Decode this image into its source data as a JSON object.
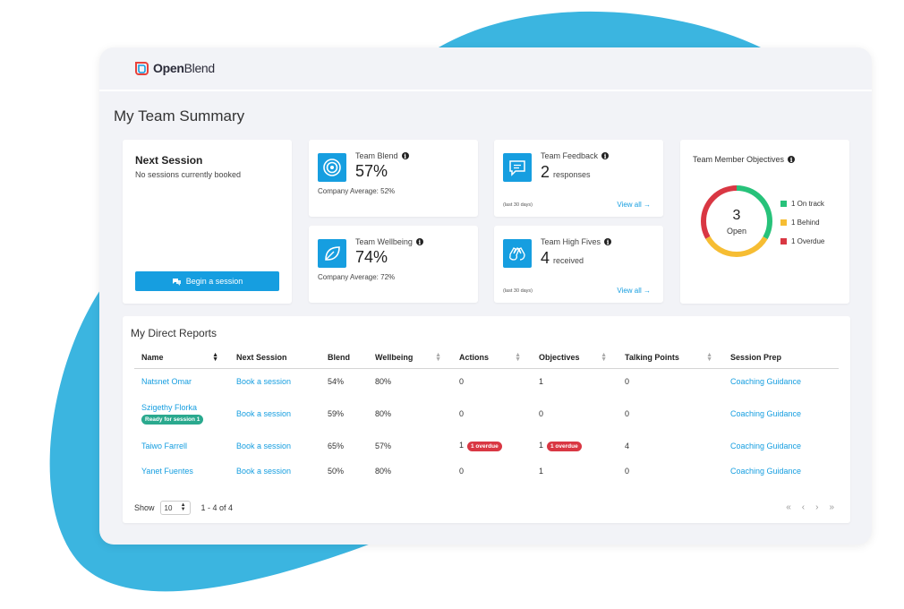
{
  "app": {
    "brand": "OpenBlend",
    "brand_bold": "Open",
    "brand_light": "Blend"
  },
  "page": {
    "title": "My Team Summary"
  },
  "next_session": {
    "title": "Next Session",
    "text": "No sessions currently booked",
    "button": "Begin a session"
  },
  "team_blend": {
    "label": "Team Blend",
    "value": "57%",
    "sub": "Company Average: 52%",
    "icon": "target-icon"
  },
  "team_wellbeing": {
    "label": "Team Wellbeing",
    "value": "74%",
    "sub": "Company Average: 72%",
    "icon": "leaf-icon"
  },
  "team_feedback": {
    "label": "Team Feedback",
    "value": "2",
    "unit": "responses",
    "period": "(last 30 days)",
    "link": "View all",
    "icon": "chat-icon"
  },
  "team_high_fives": {
    "label": "Team High Fives",
    "value": "4",
    "unit": "received",
    "period": "(last 30 days)",
    "link": "View all",
    "icon": "high-five-icon"
  },
  "objectives": {
    "title": "Team Member Objectives",
    "center_value": "3",
    "center_label": "Open",
    "segments": [
      {
        "label": "1 On track",
        "count": 1,
        "color": "#27c27a"
      },
      {
        "label": "1 Behind",
        "count": 1,
        "color": "#f6bd33"
      },
      {
        "label": "1 Overdue",
        "count": 1,
        "color": "#d93743"
      }
    ]
  },
  "reports": {
    "title": "My Direct Reports",
    "columns": [
      "Name",
      "Next Session",
      "Blend",
      "Wellbeing",
      "Actions",
      "Objectives",
      "Talking Points",
      "Session Prep"
    ],
    "rows": [
      {
        "name": "Natsnet Omar",
        "badge": "",
        "next_session": "Book a session",
        "blend": "54%",
        "wellbeing": "80%",
        "actions": "0",
        "actions_badge": "",
        "objectives": "1",
        "objectives_badge": "",
        "talking_points": "0",
        "session_prep": "Coaching Guidance"
      },
      {
        "name": "Szigethy Florka",
        "badge": "Ready for session 1",
        "next_session": "Book a session",
        "blend": "59%",
        "wellbeing": "80%",
        "actions": "0",
        "actions_badge": "",
        "objectives": "0",
        "objectives_badge": "",
        "talking_points": "0",
        "session_prep": "Coaching Guidance"
      },
      {
        "name": "Taiwo Farrell",
        "badge": "",
        "next_session": "Book a session",
        "blend": "65%",
        "wellbeing": "57%",
        "actions": "1",
        "actions_badge": "1 overdue",
        "objectives": "1",
        "objectives_badge": "1 overdue",
        "talking_points": "4",
        "session_prep": "Coaching Guidance"
      },
      {
        "name": "Yanet Fuentes",
        "badge": "",
        "next_session": "Book a session",
        "blend": "50%",
        "wellbeing": "80%",
        "actions": "0",
        "actions_badge": "",
        "objectives": "1",
        "objectives_badge": "",
        "talking_points": "0",
        "session_prep": "Coaching Guidance"
      }
    ],
    "show_label": "Show",
    "page_size": "10",
    "range": "1 - 4 of 4",
    "pager": {
      "first": "«",
      "prev": "‹",
      "next": "›",
      "last": "»"
    }
  },
  "colors": {
    "accent": "#169ee0",
    "blob": "#3bb5e0"
  }
}
